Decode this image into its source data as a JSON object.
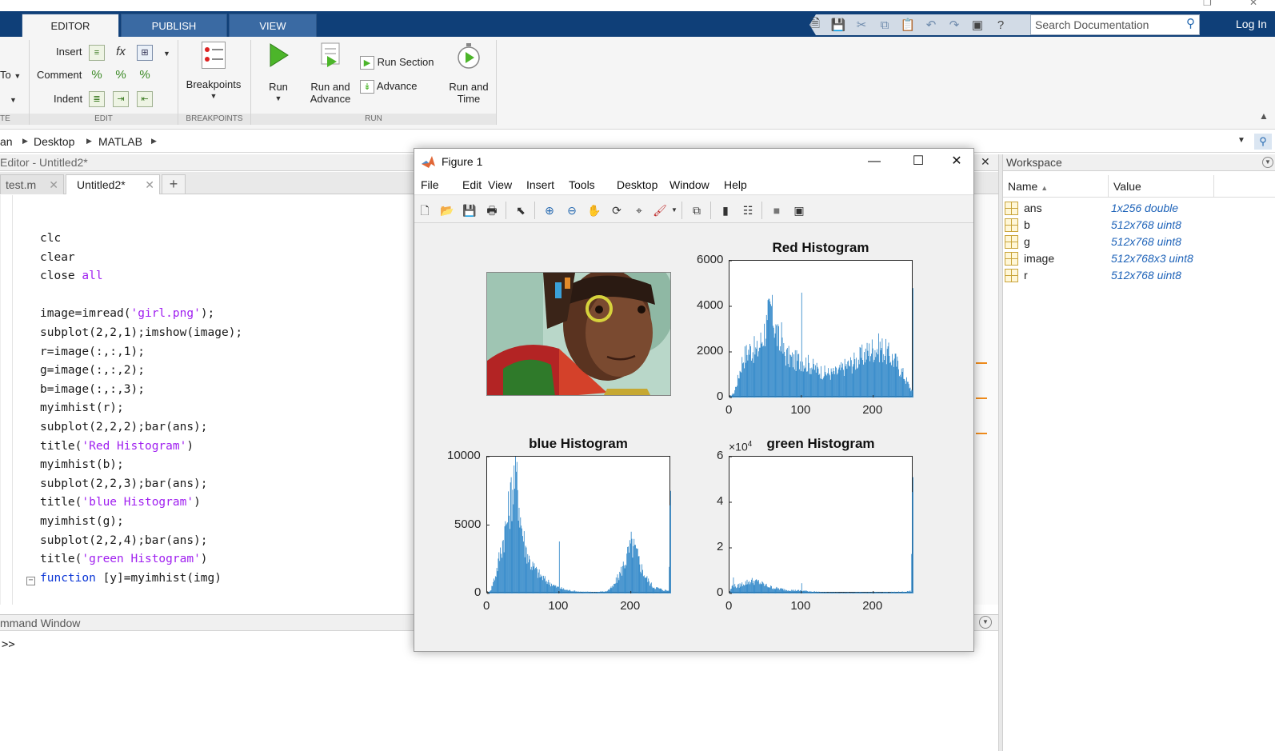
{
  "ribbon_tabs": [
    "EDITOR",
    "PUBLISH",
    "VIEW"
  ],
  "search": {
    "placeholder": "Search Documentation"
  },
  "login_label": "Log In",
  "ribbon": {
    "to_label": "To",
    "insert_label": "Insert",
    "comment_label": "Comment",
    "indent_label": "Indent",
    "breakpoints_label": "Breakpoints",
    "run_label": "Run",
    "run_advance_label_1": "Run and",
    "run_advance_label_2": "Advance",
    "run_section_label": "Run Section",
    "advance_label": "Advance",
    "run_time_label_1": "Run and",
    "run_time_label_2": "Time",
    "groups": {
      "navigate_tail": "TE",
      "edit": "EDIT",
      "breakpoints": "BREAKPOINTS",
      "run": "RUN"
    }
  },
  "address": {
    "crumbs": [
      "an",
      "Desktop",
      "MATLAB"
    ]
  },
  "editor": {
    "title": "Editor - Untitled2*",
    "tabs": [
      "test.m",
      "Untitled2*"
    ],
    "code": [
      [
        {
          "t": "clc",
          "c": ""
        }
      ],
      [
        {
          "t": "clear",
          "c": ""
        }
      ],
      [
        {
          "t": "close ",
          "c": ""
        },
        {
          "t": "all",
          "c": "str"
        }
      ],
      [
        {
          "t": "",
          "c": ""
        }
      ],
      [
        {
          "t": "image=imread(",
          "c": ""
        },
        {
          "t": "'girl.png'",
          "c": "str"
        },
        {
          "t": ");",
          "c": ""
        }
      ],
      [
        {
          "t": "subplot(2,2,1);imshow(image);",
          "c": ""
        }
      ],
      [
        {
          "t": "r=image(:,:,1);",
          "c": ""
        }
      ],
      [
        {
          "t": "g=image(:,:,2);",
          "c": ""
        }
      ],
      [
        {
          "t": "b=image(:,:,3);",
          "c": ""
        }
      ],
      [
        {
          "t": "myimhist(r);",
          "c": ""
        }
      ],
      [
        {
          "t": "subplot(2,2,2);bar(ans);",
          "c": ""
        }
      ],
      [
        {
          "t": "title(",
          "c": ""
        },
        {
          "t": "'Red Histogram'",
          "c": "str"
        },
        {
          "t": ")",
          "c": ""
        }
      ],
      [
        {
          "t": "myimhist(b);",
          "c": ""
        }
      ],
      [
        {
          "t": "subplot(2,2,3);bar(ans);",
          "c": ""
        }
      ],
      [
        {
          "t": "title(",
          "c": ""
        },
        {
          "t": "'blue Histogram'",
          "c": "str"
        },
        {
          "t": ")",
          "c": ""
        }
      ],
      [
        {
          "t": "myimhist(g);",
          "c": ""
        }
      ],
      [
        {
          "t": "subplot(2,2,4);bar(ans);",
          "c": ""
        }
      ],
      [
        {
          "t": "title(",
          "c": ""
        },
        {
          "t": "'green Histogram'",
          "c": "str"
        },
        {
          "t": ")",
          "c": ""
        }
      ],
      [
        {
          "t": "function",
          "c": "kw"
        },
        {
          "t": " [y]=myimhist(img)",
          "c": ""
        }
      ]
    ]
  },
  "command_window": {
    "title": "mmand Window",
    "prompt": ">>"
  },
  "workspace": {
    "title": "Workspace",
    "columns": [
      "Name",
      "Value"
    ],
    "vars": [
      {
        "name": "ans",
        "value": "1x256 double"
      },
      {
        "name": "b",
        "value": "512x768 uint8"
      },
      {
        "name": "g",
        "value": "512x768 uint8"
      },
      {
        "name": "image",
        "value": "512x768x3 uint8"
      },
      {
        "name": "r",
        "value": "512x768 uint8"
      }
    ]
  },
  "figure": {
    "title": "Figure 1",
    "menu": [
      "File",
      "Edit",
      "View",
      "Insert",
      "Tools",
      "Desktop",
      "Window",
      "Help"
    ]
  },
  "chart_data": [
    {
      "type": "bar",
      "title": "Red Histogram",
      "xlim": [
        0,
        256
      ],
      "ylim": [
        0,
        6000
      ],
      "xticks": [
        0,
        100,
        200
      ],
      "yticks": [
        0,
        2000,
        4000,
        6000
      ],
      "color": "#2a84c7",
      "peaks": [
        [
          0,
          50
        ],
        [
          6,
          200
        ],
        [
          12,
          900
        ],
        [
          18,
          1700
        ],
        [
          25,
          2000
        ],
        [
          30,
          2150
        ],
        [
          38,
          2000
        ],
        [
          45,
          2600
        ],
        [
          52,
          3300
        ],
        [
          58,
          4000
        ],
        [
          63,
          3100
        ],
        [
          70,
          2200
        ],
        [
          80,
          1800
        ],
        [
          90,
          1600
        ],
        [
          100,
          1650
        ],
        [
          110,
          1450
        ],
        [
          120,
          1250
        ],
        [
          130,
          1100
        ],
        [
          140,
          1050
        ],
        [
          150,
          1100
        ],
        [
          160,
          1350
        ],
        [
          170,
          1500
        ],
        [
          180,
          1700
        ],
        [
          190,
          1950
        ],
        [
          200,
          2150
        ],
        [
          210,
          2200
        ],
        [
          220,
          1900
        ],
        [
          230,
          1600
        ],
        [
          240,
          1100
        ],
        [
          248,
          600
        ],
        [
          254,
          250
        ],
        [
          255,
          4800
        ]
      ],
      "spikes": [
        [
          59,
          4500
        ],
        [
          100,
          4600
        ],
        [
          72,
          3300
        ],
        [
          52,
          3400
        ]
      ]
    },
    {
      "type": "bar",
      "title": "blue Histogram",
      "xlim": [
        0,
        256
      ],
      "ylim": [
        0,
        10000
      ],
      "xticks": [
        0,
        100,
        200
      ],
      "yticks": [
        0,
        5000,
        10000
      ],
      "color": "#2a84c7",
      "peaks": [
        [
          0,
          0
        ],
        [
          5,
          300
        ],
        [
          12,
          1500
        ],
        [
          20,
          3500
        ],
        [
          28,
          5500
        ],
        [
          34,
          7500
        ],
        [
          38,
          8500
        ],
        [
          42,
          7800
        ],
        [
          46,
          5500
        ],
        [
          52,
          3500
        ],
        [
          60,
          2200
        ],
        [
          70,
          1500
        ],
        [
          80,
          1000
        ],
        [
          95,
          500
        ],
        [
          110,
          250
        ],
        [
          130,
          120
        ],
        [
          150,
          100
        ],
        [
          165,
          150
        ],
        [
          175,
          500
        ],
        [
          185,
          1500
        ],
        [
          195,
          2800
        ],
        [
          200,
          3600
        ],
        [
          206,
          3100
        ],
        [
          212,
          2200
        ],
        [
          220,
          1200
        ],
        [
          230,
          500
        ],
        [
          245,
          250
        ],
        [
          252,
          200
        ],
        [
          255,
          7500
        ]
      ],
      "spikes": [
        [
          100,
          3800
        ],
        [
          40,
          8900
        ],
        [
          198,
          3900
        ]
      ]
    },
    {
      "type": "bar",
      "title": "green Histogram",
      "exponent_label": "×10",
      "exponent_power": "4",
      "xlim": [
        0,
        256
      ],
      "ylim": [
        0,
        6
      ],
      "xticks": [
        0,
        100,
        200
      ],
      "yticks": [
        0,
        2,
        4,
        6
      ],
      "color": "#2a84c7",
      "peaks": [
        [
          0,
          0.1
        ],
        [
          4,
          0.35
        ],
        [
          10,
          0.3
        ],
        [
          20,
          0.45
        ],
        [
          30,
          0.55
        ],
        [
          40,
          0.5
        ],
        [
          50,
          0.35
        ],
        [
          60,
          0.25
        ],
        [
          80,
          0.15
        ],
        [
          100,
          0.12
        ],
        [
          130,
          0.05
        ],
        [
          160,
          0.04
        ],
        [
          200,
          0.05
        ],
        [
          230,
          0.06
        ],
        [
          245,
          0.08
        ],
        [
          252,
          0.1
        ],
        [
          255,
          5.1
        ]
      ],
      "spikes": [
        [
          100,
          0.45
        ],
        [
          5,
          0.7
        ]
      ]
    }
  ]
}
